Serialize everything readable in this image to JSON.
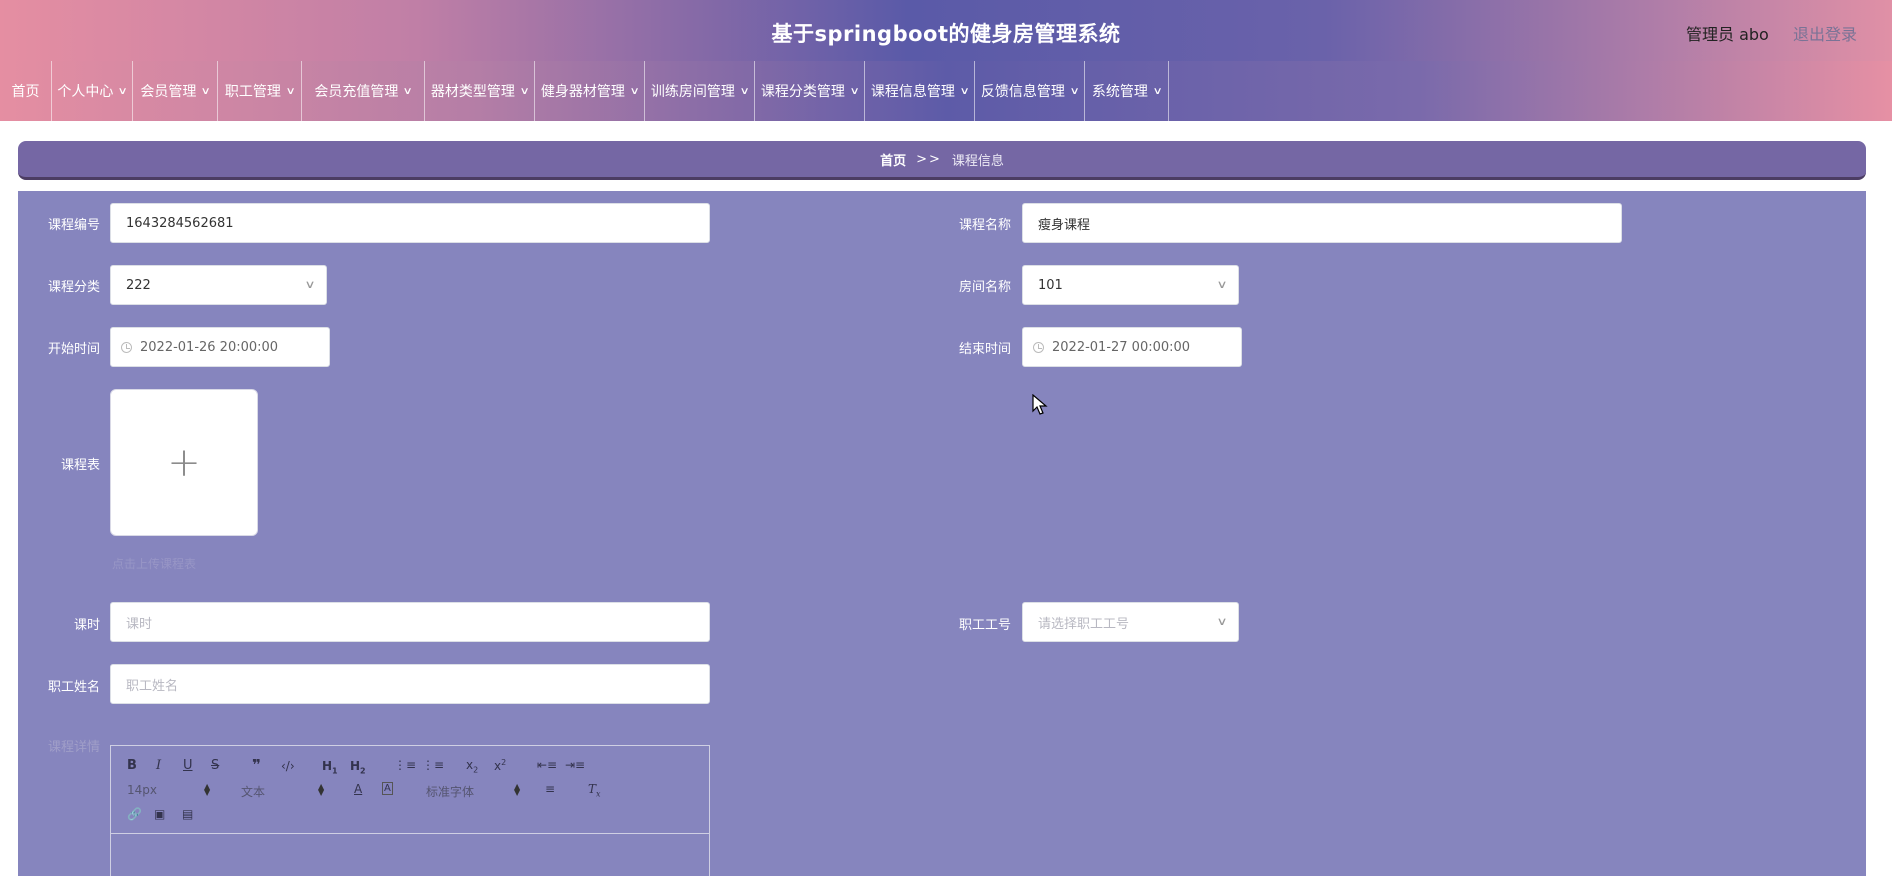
{
  "header": {
    "title": "基于springboot的健身房管理系统",
    "user_label": "管理员 abo",
    "logout_label": "退出登录"
  },
  "nav": {
    "items": [
      {
        "label": "首页",
        "has_menu": false
      },
      {
        "label": "个人中心",
        "has_menu": true
      },
      {
        "label": "会员管理",
        "has_menu": true
      },
      {
        "label": "职工管理",
        "has_menu": true
      },
      {
        "label": "会员充值管理",
        "has_menu": true
      },
      {
        "label": "器材类型管理",
        "has_menu": true
      },
      {
        "label": "健身器材管理",
        "has_menu": true
      },
      {
        "label": "训练房间管理",
        "has_menu": true
      },
      {
        "label": "课程分类管理",
        "has_menu": true
      },
      {
        "label": "课程信息管理",
        "has_menu": true
      },
      {
        "label": "反馈信息管理",
        "has_menu": true
      },
      {
        "label": "系统管理",
        "has_menu": true
      }
    ]
  },
  "breadcrumb": {
    "home": "首页",
    "separator": ">>",
    "current": "课程信息"
  },
  "form": {
    "course_no": {
      "label": "课程编号",
      "value": "1643284562681"
    },
    "course_name": {
      "label": "课程名称",
      "value": "瘦身课程"
    },
    "course_category": {
      "label": "课程分类",
      "value": "222"
    },
    "room_name": {
      "label": "房间名称",
      "value": "101"
    },
    "start_time": {
      "label": "开始时间",
      "value": "2022-01-26 20:00:00"
    },
    "end_time": {
      "label": "结束时间",
      "value": "2022-01-27 00:00:00"
    },
    "schedule": {
      "label": "课程表",
      "upload_icon": "plus-icon",
      "tip": "点击上传课程表"
    },
    "hours": {
      "label": "课时",
      "value": "",
      "placeholder": "课时"
    },
    "staff_no": {
      "label": "职工工号",
      "value": "",
      "placeholder": "请选择职工工号"
    },
    "staff_name": {
      "label": "职工姓名",
      "value": "",
      "placeholder": "职工姓名"
    },
    "details": {
      "label": "课程详情"
    }
  },
  "editor": {
    "font_size": "14px",
    "header_picker": "文本",
    "font_family": "标准字体"
  },
  "colors": {
    "panel": "#8685be",
    "breadcrumb": "#7567a4",
    "nav_gradient_mid": "#5d5ba8",
    "header_gradient_edge": "#e58ea2"
  }
}
